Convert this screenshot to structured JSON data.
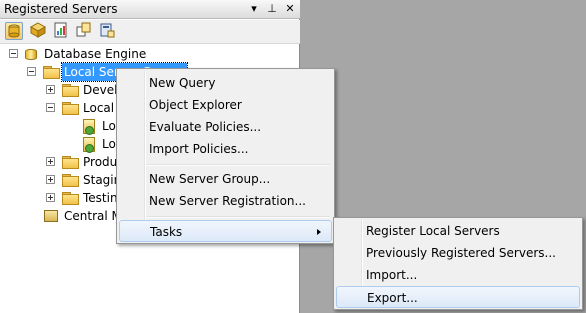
{
  "panel": {
    "title": "Registered Servers",
    "title_icons": [
      "pin-down-icon",
      "pin-icon",
      "close-icon"
    ],
    "title_glyphs": [
      "▾",
      "⊥",
      "✕"
    ],
    "toolbar_icons": [
      "database-engine-icon",
      "analysis-services-icon",
      "reporting-services-icon",
      "integration-services-icon",
      "compact-edition-icon"
    ]
  },
  "tree": {
    "database_engine": "Database Engine",
    "local_server_groups": "Local Server Groups",
    "development": "Development",
    "local": "Local",
    "server1": "Local",
    "server2": "Local",
    "production": "Production",
    "staging": "Staging",
    "testing": "Testing",
    "central": "Central Management Servers"
  },
  "menu": {
    "items": [
      "New Query",
      "Object Explorer",
      "Evaluate Policies...",
      "Import Policies...",
      "New Server Group...",
      "New Server Registration...",
      "Tasks"
    ]
  },
  "submenu": {
    "items": [
      "Register Local Servers",
      "Previously Registered Servers...",
      "Import...",
      "Export..."
    ]
  },
  "colors": {
    "selection": "#3399ff",
    "menu_hover": "#dde9f8",
    "workspace": "#a6a6a6"
  }
}
